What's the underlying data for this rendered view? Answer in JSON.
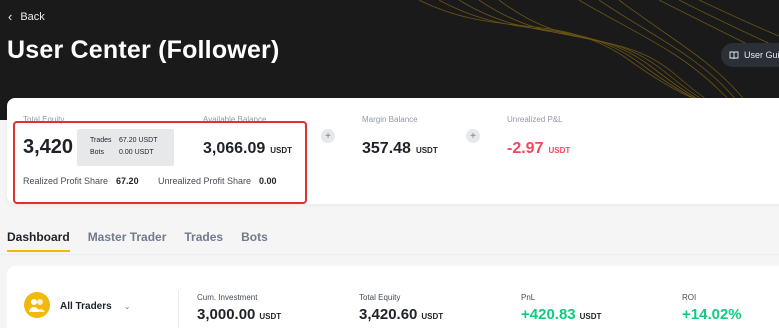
{
  "header": {
    "back_label": "Back",
    "title": "User Center (Follower)",
    "guide_label": "User Guide"
  },
  "summary": {
    "total_equity": {
      "label": "Total Equity",
      "value": "3,420"
    },
    "tooltip": {
      "trades_label": "Trades",
      "trades_value": "67.20 USDT",
      "bots_label": "Bots",
      "bots_value": "0.00 USDT"
    },
    "available_balance": {
      "label": "Available Balance",
      "value": "3,066.09",
      "unit": "USDT"
    },
    "margin_balance": {
      "label": "Margin Balance",
      "value": "357.48",
      "unit": "USDT"
    },
    "unrealized_pnl": {
      "label": "Unrealized P&L",
      "value": "-2.97",
      "unit": "USDT"
    },
    "realized_profit_share": {
      "label": "Realized Profit Share",
      "value": "67.20"
    },
    "unrealized_profit_share": {
      "label": "Unrealized Profit Share",
      "value": "0.00"
    },
    "plus_symbol": "+"
  },
  "tabs": [
    {
      "label": "Dashboard",
      "active": true
    },
    {
      "label": "Master Trader",
      "active": false
    },
    {
      "label": "Trades",
      "active": false
    },
    {
      "label": "Bots",
      "active": false
    }
  ],
  "stats": {
    "selector_label": "All Traders",
    "cum_investment": {
      "label": "Cum. Investment",
      "value": "3,000.00",
      "unit": "USDT"
    },
    "total_equity": {
      "label": "Total Equity",
      "value": "3,420.60",
      "unit": "USDT"
    },
    "pnl": {
      "label": "PnL",
      "value": "+420.83",
      "unit": "USDT"
    },
    "roi": {
      "label": "ROI",
      "value": "+14.02%"
    }
  },
  "colors": {
    "accent": "#f0b90b",
    "positive": "#0ecb81",
    "negative": "#f6465d",
    "highlight_border": "#e03131"
  }
}
